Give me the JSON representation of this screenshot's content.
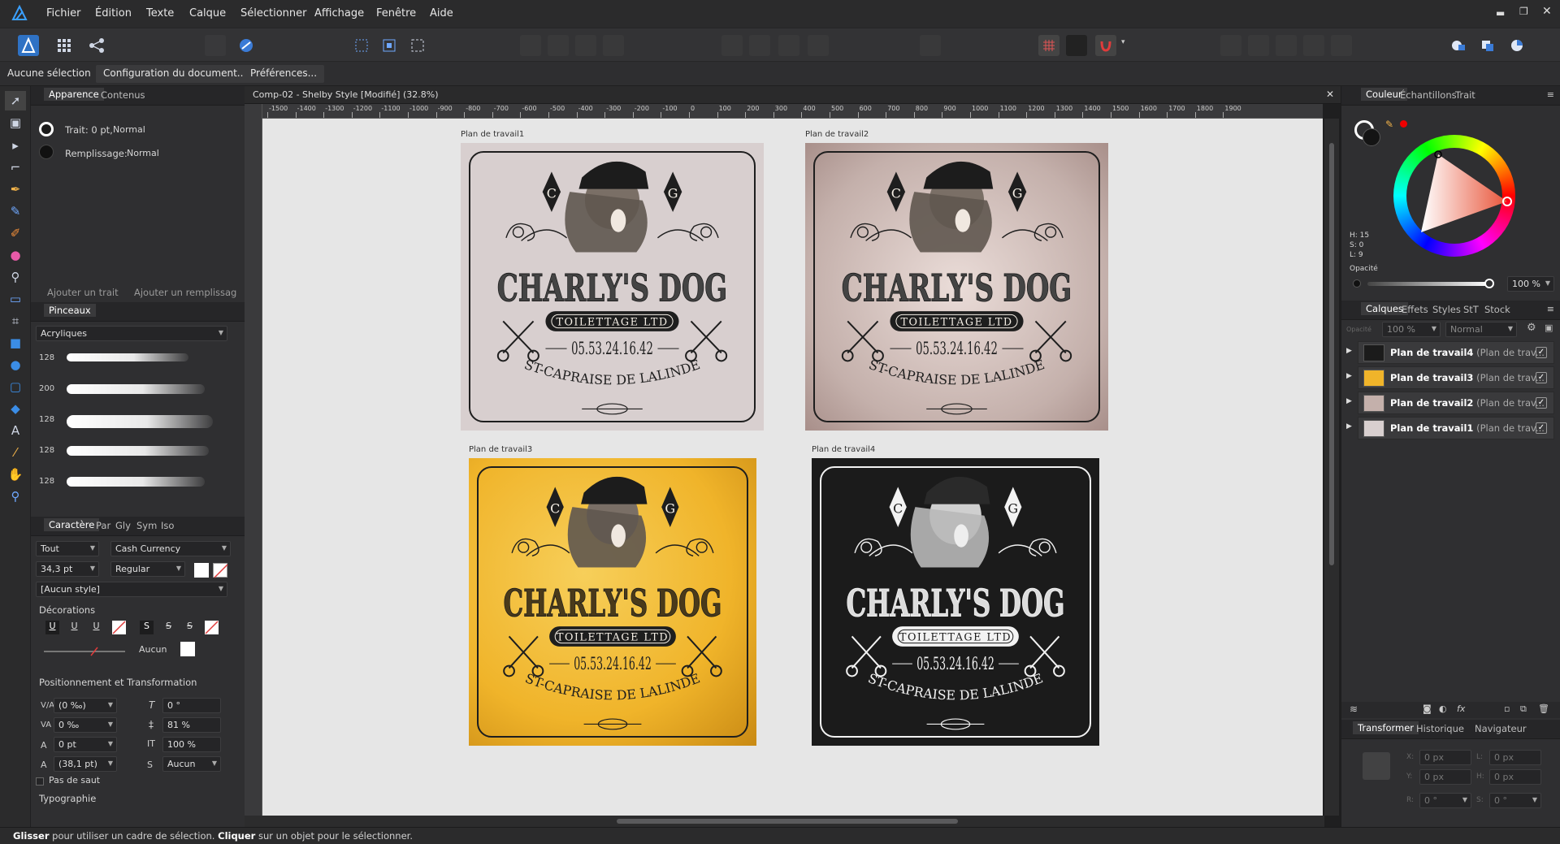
{
  "menu": [
    "Fichier",
    "Édition",
    "Texte",
    "Calque",
    "Sélectionner",
    "Affichage",
    "Fenêtre",
    "Aide"
  ],
  "context_bar": {
    "selection": "Aucune sélection",
    "doc_setup": "Configuration du document...",
    "prefs": "Préférences..."
  },
  "document": {
    "title": "Comp-02 - Shelby Style [Modifié] (32.8%)"
  },
  "ruler_ticks": [
    "-1500",
    "-1400",
    "-1300",
    "-1200",
    "-1100",
    "-1000",
    "-900",
    "-800",
    "-700",
    "-600",
    "-500",
    "-400",
    "-300",
    "-200",
    "-100",
    "0",
    "100",
    "200",
    "300",
    "400",
    "500",
    "600",
    "700",
    "800",
    "900",
    "1000",
    "1100",
    "1200",
    "1300",
    "1400",
    "1500",
    "1600",
    "1700",
    "1800",
    "1900"
  ],
  "ruler_unit": "px",
  "appearance": {
    "tab_appearance": "Apparence",
    "tab_contents": "Contenus",
    "stroke_label": "Trait: 0 pt,",
    "stroke_mode": "Normal",
    "fill_label": "Remplissage:",
    "fill_mode": "Normal",
    "add_stroke": "Ajouter un trait",
    "add_fill": "Ajouter un remplissag"
  },
  "brushes": {
    "tab": "Pinceaux",
    "category": "Acryliques",
    "sizes": [
      "128",
      "200",
      "128",
      "128",
      "128"
    ]
  },
  "character": {
    "tabs": [
      "Caractère",
      "Par",
      "Gly",
      "Sym",
      "Iso"
    ],
    "scope": "Tout",
    "font": "Cash Currency",
    "size": "34,3 pt",
    "weight": "Regular",
    "style": "[Aucun style]",
    "decorations": "Décorations",
    "underline_none": "Aucun",
    "pos_transform": "Positionnement et Transformation",
    "kerning": "(0 ‰)",
    "tracking": "0 ‰",
    "baseline": "0 pt",
    "leading": "(38,1 pt)",
    "slant": "0 °",
    "vscale": "81 %",
    "hscale": "100 %",
    "script": "Aucun",
    "no_break": "Pas de saut",
    "typography": "Typographie"
  },
  "artboards": [
    {
      "label": "Plan de travail1",
      "bg": "#d8cfcf"
    },
    {
      "label": "Plan de travail2",
      "bg": "#c4b0ab"
    },
    {
      "label": "Plan de travail3",
      "bg": "#f0b42a"
    },
    {
      "label": "Plan de travail4",
      "bg": "#1b1b1b"
    }
  ],
  "logo": {
    "left_letter": "C",
    "right_letter": "G",
    "name": "CHARLY'S DOG",
    "banner": "TOILETTAGE LTD",
    "phone": "05.53.24.16.42",
    "town": "ST-CAPRAISE DE LALINDE"
  },
  "color": {
    "tabs": [
      "Couleur",
      "Échantillons",
      "Trait"
    ],
    "h": "H: 15",
    "s": "S: 0",
    "l": "L: 9",
    "opacity_label": "Opacité",
    "opacity": "100 %"
  },
  "layers": {
    "tabs": [
      "Calques",
      "Effets",
      "Styles",
      "StT",
      "Stock"
    ],
    "opacity": "100 %",
    "blend": "Normal",
    "opacity_hint": "Opacité",
    "items": [
      {
        "name": "Plan de travail4",
        "sub": "(Plan de trav...",
        "thumb": "#1b1b1b"
      },
      {
        "name": "Plan de travail3",
        "sub": "(Plan de trav...",
        "thumb": "#f0b42a"
      },
      {
        "name": "Plan de travail2",
        "sub": "(Plan de trav...",
        "thumb": "#c4b0ab"
      },
      {
        "name": "Plan de travail1",
        "sub": "(Plan de trav...",
        "thumb": "#d8cfcf"
      }
    ]
  },
  "transform": {
    "tabs": [
      "Transformer",
      "Historique",
      "Navigateur"
    ],
    "x": "0 px",
    "y": "0 px",
    "w": "0 px",
    "h": "0 px",
    "r": "0 °",
    "s": "0 °",
    "xl": "X:",
    "yl": "Y:",
    "wl": "L:",
    "hl": "H:",
    "rl": "R:",
    "sl": "S:"
  },
  "status": {
    "b1": "Glisser",
    "t1": " pour utiliser un cadre de sélection. ",
    "b2": "Cliquer",
    "t2": " sur un objet pour le sélectionner."
  }
}
